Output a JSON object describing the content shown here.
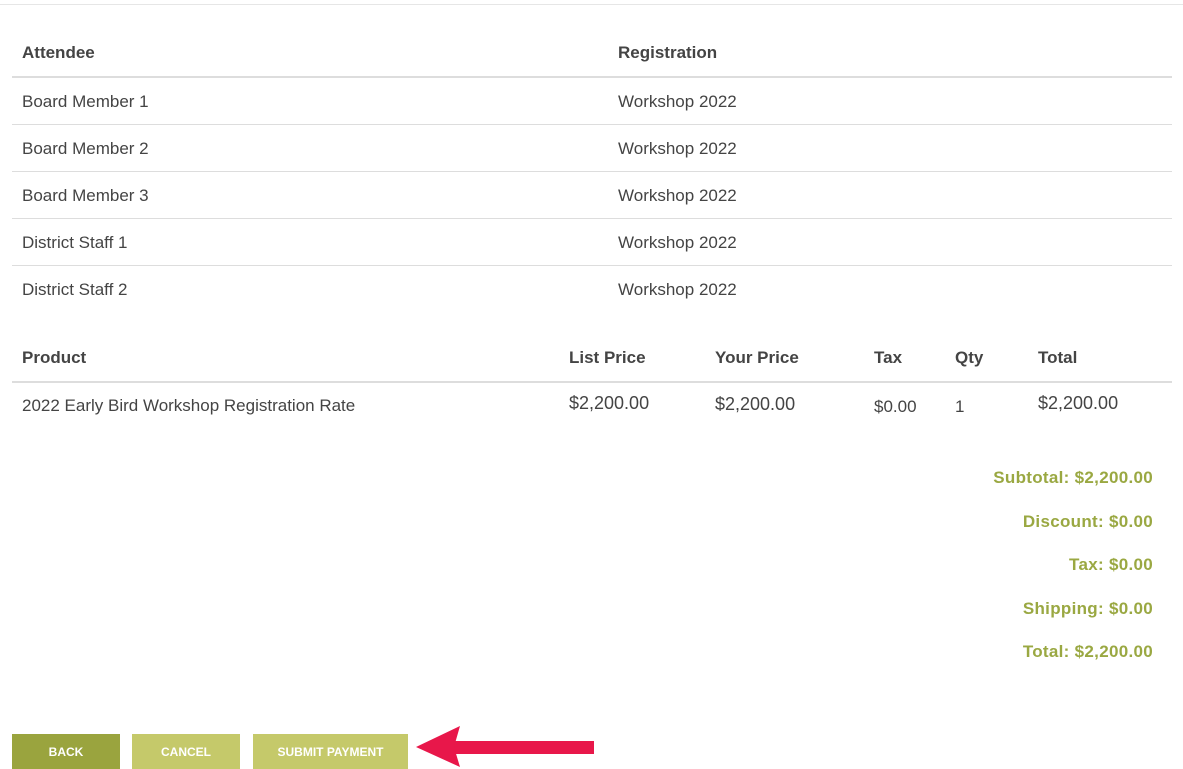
{
  "attendees": {
    "headers": {
      "attendee": "Attendee",
      "registration": "Registration"
    },
    "rows": [
      {
        "attendee": "Board Member 1",
        "registration": "Workshop 2022"
      },
      {
        "attendee": "Board Member 2",
        "registration": "Workshop 2022"
      },
      {
        "attendee": "Board Member 3",
        "registration": "Workshop 2022"
      },
      {
        "attendee": "District Staff 1",
        "registration": "Workshop 2022"
      },
      {
        "attendee": "District Staff 2",
        "registration": "Workshop 2022"
      }
    ]
  },
  "products": {
    "headers": {
      "product": "Product",
      "list_price": "List Price",
      "your_price": "Your Price",
      "tax": "Tax",
      "qty": "Qty",
      "total": "Total"
    },
    "rows": [
      {
        "product": "2022 Early Bird Workshop Registration Rate",
        "list_price": "$2,200.00",
        "your_price": "$2,200.00",
        "tax": "$0.00",
        "qty": "1",
        "total": "$2,200.00"
      }
    ]
  },
  "totals": {
    "subtotal": "Subtotal: $2,200.00",
    "discount": "Discount: $0.00",
    "tax": "Tax: $0.00",
    "shipping": "Shipping: $0.00",
    "total": "Total: $2,200.00"
  },
  "buttons": {
    "back": "BACK",
    "cancel": "CANCEL",
    "submit": "SUBMIT PAYMENT"
  },
  "colors": {
    "accent_olive": "#9aa43e",
    "accent_light": "#c5c96a",
    "totals_text": "#9aa842",
    "annotation_arrow": "#e8174a"
  },
  "icons": {
    "annotation": "arrow-left-icon"
  }
}
